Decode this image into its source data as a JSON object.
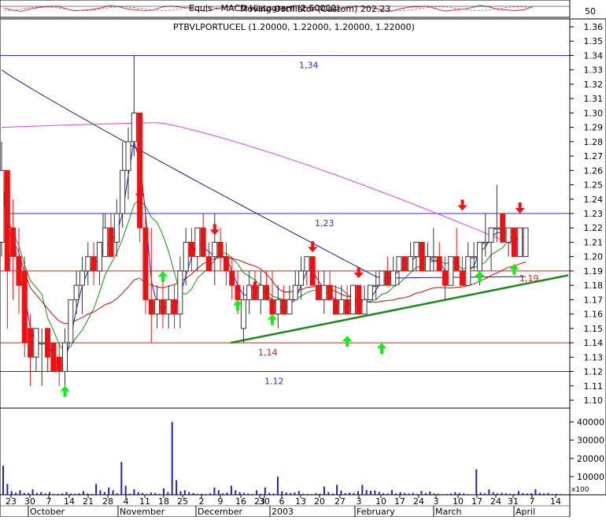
{
  "chart_data": {
    "type": "candlestick",
    "title": "PTBVLPORTUCEL (1.20000, 1.22000, 1.20000, 1.22000)",
    "indicator_panel": {
      "legend": "Equis - MACD Histogram (2.50000)",
      "legend_overlap": "Moving Oscillator (Custom) 202.23",
      "axis_label": "50"
    },
    "y_axis": {
      "min": 1.1,
      "max": 1.36,
      "ticks": [
        "1.10",
        "1.11",
        "1.12",
        "1.13",
        "1.14",
        "1.15",
        "1.16",
        "1.17",
        "1.18",
        "1.19",
        "1.20",
        "1.21",
        "1.22",
        "1.23",
        "1.24",
        "1.25",
        "1.26",
        "1.27",
        "1.28",
        "1.29",
        "1.30",
        "1.31",
        "1.32",
        "1.33",
        "1.34",
        "1.35",
        "1.36"
      ]
    },
    "volume_axis": {
      "max": 45000,
      "ticks": [
        "10000",
        "20000",
        "30000",
        "40000"
      ],
      "unit_label": "x100"
    },
    "x_axis": {
      "day_ticks": [
        "23",
        "30",
        "7",
        "14",
        "21",
        "28",
        "4",
        "11",
        "18",
        "25",
        "2",
        "9",
        "16",
        "23",
        "30",
        "6",
        "13",
        "20",
        "27",
        "3",
        "10",
        "17",
        "24",
        "3",
        "10",
        "17",
        "24",
        "31",
        "7",
        "14"
      ],
      "month_labels": [
        "October",
        "November",
        "December",
        "2003",
        "February",
        "March",
        "April"
      ]
    },
    "horizontal_levels": [
      {
        "value": 1.34,
        "label": "1,34",
        "color": "#2a2ac8"
      },
      {
        "value": 1.23,
        "label": "1,23",
        "color": "#2a2ac8"
      },
      {
        "value": 1.19,
        "label": "1,19",
        "color": "#cc2222"
      },
      {
        "value": 1.14,
        "label": "1,14",
        "color": "#cc2222"
      },
      {
        "value": 1.12,
        "label": "1.12",
        "color": "#2a2ac8"
      }
    ],
    "trendline": {
      "color": "#1a8a1a"
    },
    "colors": {
      "down": "#ee1111",
      "up_fill": "#ffffff",
      "up_stroke": "#333333",
      "ma_slow": "#dd44dd",
      "ma_mid": "#1a1a80",
      "ma_fast": "#1a1acc",
      "ma_green": "#1a8a1a",
      "ma_red": "#bb1111",
      "arrow_up": "#11ee11",
      "arrow_down": "#ee1111",
      "volume": "#2222bb",
      "grid": "#000000"
    },
    "bars": [
      {
        "o": 1.21,
        "h": 1.28,
        "l": 1.2,
        "c": 1.26
      },
      {
        "o": 1.26,
        "h": 1.26,
        "l": 1.15,
        "c": 1.19
      },
      {
        "o": 1.22,
        "h": 1.24,
        "l": 1.17,
        "c": 1.2
      },
      {
        "o": 1.2,
        "h": 1.22,
        "l": 1.16,
        "c": 1.18
      },
      {
        "o": 1.19,
        "h": 1.2,
        "l": 1.13,
        "c": 1.14
      },
      {
        "o": 1.15,
        "h": 1.16,
        "l": 1.11,
        "c": 1.13
      },
      {
        "o": 1.13,
        "h": 1.15,
        "l": 1.12,
        "c": 1.15
      },
      {
        "o": 1.14,
        "h": 1.15,
        "l": 1.11,
        "c": 1.14
      },
      {
        "o": 1.15,
        "h": 1.15,
        "l": 1.12,
        "c": 1.13
      },
      {
        "o": 1.14,
        "h": 1.14,
        "l": 1.12,
        "c": 1.12
      },
      {
        "o": 1.13,
        "h": 1.14,
        "l": 1.11,
        "c": 1.12
      },
      {
        "o": 1.12,
        "h": 1.15,
        "l": 1.11,
        "c": 1.14
      },
      {
        "o": 1.14,
        "h": 1.17,
        "l": 1.14,
        "c": 1.17
      },
      {
        "o": 1.17,
        "h": 1.19,
        "l": 1.16,
        "c": 1.18
      },
      {
        "o": 1.18,
        "h": 1.2,
        "l": 1.16,
        "c": 1.19
      },
      {
        "o": 1.19,
        "h": 1.21,
        "l": 1.18,
        "c": 1.2
      },
      {
        "o": 1.2,
        "h": 1.21,
        "l": 1.18,
        "c": 1.19
      },
      {
        "o": 1.19,
        "h": 1.21,
        "l": 1.18,
        "c": 1.21
      },
      {
        "o": 1.2,
        "h": 1.23,
        "l": 1.2,
        "c": 1.22
      },
      {
        "o": 1.22,
        "h": 1.23,
        "l": 1.2,
        "c": 1.2
      },
      {
        "o": 1.21,
        "h": 1.24,
        "l": 1.2,
        "c": 1.23
      },
      {
        "o": 1.23,
        "h": 1.28,
        "l": 1.22,
        "c": 1.26
      },
      {
        "o": 1.26,
        "h": 1.29,
        "l": 1.24,
        "c": 1.28
      },
      {
        "o": 1.28,
        "h": 1.34,
        "l": 1.27,
        "c": 1.3
      },
      {
        "o": 1.3,
        "h": 1.3,
        "l": 1.21,
        "c": 1.22
      },
      {
        "o": 1.22,
        "h": 1.23,
        "l": 1.16,
        "c": 1.17
      },
      {
        "o": 1.17,
        "h": 1.22,
        "l": 1.14,
        "c": 1.16
      },
      {
        "o": 1.16,
        "h": 1.18,
        "l": 1.15,
        "c": 1.17
      },
      {
        "o": 1.17,
        "h": 1.19,
        "l": 1.15,
        "c": 1.16
      },
      {
        "o": 1.16,
        "h": 1.18,
        "l": 1.15,
        "c": 1.17
      },
      {
        "o": 1.17,
        "h": 1.18,
        "l": 1.15,
        "c": 1.16
      },
      {
        "o": 1.16,
        "h": 1.2,
        "l": 1.15,
        "c": 1.19
      },
      {
        "o": 1.19,
        "h": 1.22,
        "l": 1.18,
        "c": 1.21
      },
      {
        "o": 1.21,
        "h": 1.22,
        "l": 1.19,
        "c": 1.2
      },
      {
        "o": 1.2,
        "h": 1.22,
        "l": 1.19,
        "c": 1.22
      },
      {
        "o": 1.22,
        "h": 1.23,
        "l": 1.2,
        "c": 1.2
      },
      {
        "o": 1.2,
        "h": 1.21,
        "l": 1.19,
        "c": 1.19
      },
      {
        "o": 1.2,
        "h": 1.23,
        "l": 1.18,
        "c": 1.21
      },
      {
        "o": 1.21,
        "h": 1.22,
        "l": 1.19,
        "c": 1.2
      },
      {
        "o": 1.2,
        "h": 1.21,
        "l": 1.18,
        "c": 1.19
      },
      {
        "o": 1.19,
        "h": 1.2,
        "l": 1.17,
        "c": 1.18
      },
      {
        "o": 1.18,
        "h": 1.19,
        "l": 1.16,
        "c": 1.17
      },
      {
        "o": 1.15,
        "h": 1.18,
        "l": 1.14,
        "c": 1.17
      },
      {
        "o": 1.17,
        "h": 1.19,
        "l": 1.16,
        "c": 1.18
      },
      {
        "o": 1.18,
        "h": 1.19,
        "l": 1.17,
        "c": 1.17
      },
      {
        "o": 1.17,
        "h": 1.19,
        "l": 1.16,
        "c": 1.18
      },
      {
        "o": 1.18,
        "h": 1.19,
        "l": 1.17,
        "c": 1.17
      },
      {
        "o": 1.17,
        "h": 1.19,
        "l": 1.16,
        "c": 1.16
      },
      {
        "o": 1.16,
        "h": 1.18,
        "l": 1.15,
        "c": 1.17
      },
      {
        "o": 1.17,
        "h": 1.18,
        "l": 1.16,
        "c": 1.16
      },
      {
        "o": 1.16,
        "h": 1.18,
        "l": 1.16,
        "c": 1.17
      },
      {
        "o": 1.17,
        "h": 1.19,
        "l": 1.17,
        "c": 1.18
      },
      {
        "o": 1.18,
        "h": 1.2,
        "l": 1.17,
        "c": 1.19
      },
      {
        "o": 1.19,
        "h": 1.2,
        "l": 1.18,
        "c": 1.2
      },
      {
        "o": 1.2,
        "h": 1.2,
        "l": 1.18,
        "c": 1.18
      },
      {
        "o": 1.18,
        "h": 1.19,
        "l": 1.17,
        "c": 1.17
      },
      {
        "o": 1.17,
        "h": 1.19,
        "l": 1.16,
        "c": 1.18
      },
      {
        "o": 1.18,
        "h": 1.19,
        "l": 1.17,
        "c": 1.17
      },
      {
        "o": 1.17,
        "h": 1.18,
        "l": 1.16,
        "c": 1.16
      },
      {
        "o": 1.16,
        "h": 1.18,
        "l": 1.16,
        "c": 1.17
      },
      {
        "o": 1.17,
        "h": 1.18,
        "l": 1.16,
        "c": 1.16
      },
      {
        "o": 1.16,
        "h": 1.18,
        "l": 1.16,
        "c": 1.18
      },
      {
        "o": 1.18,
        "h": 1.18,
        "l": 1.16,
        "c": 1.16
      },
      {
        "o": 1.16,
        "h": 1.18,
        "l": 1.16,
        "c": 1.17
      },
      {
        "o": 1.17,
        "h": 1.18,
        "l": 1.17,
        "c": 1.18
      },
      {
        "o": 1.18,
        "h": 1.19,
        "l": 1.17,
        "c": 1.18
      },
      {
        "o": 1.18,
        "h": 1.19,
        "l": 1.18,
        "c": 1.19
      },
      {
        "o": 1.19,
        "h": 1.2,
        "l": 1.18,
        "c": 1.18
      },
      {
        "o": 1.18,
        "h": 1.2,
        "l": 1.18,
        "c": 1.19
      },
      {
        "o": 1.19,
        "h": 1.2,
        "l": 1.18,
        "c": 1.2
      },
      {
        "o": 1.2,
        "h": 1.2,
        "l": 1.19,
        "c": 1.19
      },
      {
        "o": 1.19,
        "h": 1.21,
        "l": 1.19,
        "c": 1.2
      },
      {
        "o": 1.2,
        "h": 1.21,
        "l": 1.19,
        "c": 1.21
      },
      {
        "o": 1.21,
        "h": 1.21,
        "l": 1.19,
        "c": 1.19
      },
      {
        "o": 1.19,
        "h": 1.21,
        "l": 1.19,
        "c": 1.2
      },
      {
        "o": 1.2,
        "h": 1.22,
        "l": 1.19,
        "c": 1.2
      },
      {
        "o": 1.2,
        "h": 1.21,
        "l": 1.19,
        "c": 1.19
      },
      {
        "o": 1.19,
        "h": 1.2,
        "l": 1.17,
        "c": 1.18
      },
      {
        "o": 1.18,
        "h": 1.2,
        "l": 1.18,
        "c": 1.2
      },
      {
        "o": 1.2,
        "h": 1.22,
        "l": 1.19,
        "c": 1.19
      },
      {
        "o": 1.19,
        "h": 1.2,
        "l": 1.18,
        "c": 1.18
      },
      {
        "o": 1.18,
        "h": 1.21,
        "l": 1.18,
        "c": 1.2
      },
      {
        "o": 1.2,
        "h": 1.21,
        "l": 1.19,
        "c": 1.2
      },
      {
        "o": 1.19,
        "h": 1.21,
        "l": 1.18,
        "c": 1.21
      },
      {
        "o": 1.21,
        "h": 1.23,
        "l": 1.2,
        "c": 1.21
      },
      {
        "o": 1.21,
        "h": 1.22,
        "l": 1.19,
        "c": 1.22
      },
      {
        "o": 1.22,
        "h": 1.25,
        "l": 1.21,
        "c": 1.22
      },
      {
        "o": 1.23,
        "h": 1.23,
        "l": 1.21,
        "c": 1.21
      },
      {
        "o": 1.21,
        "h": 1.22,
        "l": 1.2,
        "c": 1.22
      },
      {
        "o": 1.22,
        "h": 1.22,
        "l": 1.2,
        "c": 1.2
      },
      {
        "o": 1.2,
        "h": 1.22,
        "l": 1.2,
        "c": 1.22
      },
      {
        "o": 1.2,
        "h": 1.22,
        "l": 1.2,
        "c": 1.22
      }
    ],
    "volume": [
      16000,
      6000,
      2000,
      1200,
      2500,
      1000,
      1000,
      3000,
      1000,
      1500,
      800,
      1500,
      500,
      500,
      800,
      1500,
      700,
      600,
      800,
      2000,
      700,
      500,
      6000,
      2500,
      1500,
      4000,
      2500,
      800,
      18000,
      5000,
      600,
      3000,
      1500,
      1000,
      500,
      1200,
      1000,
      500,
      3500,
      1500,
      40000,
      8000,
      2000,
      2500,
      1500,
      1000,
      500,
      600,
      400,
      800,
      4000,
      2500,
      800,
      1200,
      5000,
      2500,
      1500,
      1000,
      700,
      500,
      2500,
      600,
      4000,
      1000,
      700,
      10000,
      2000,
      1300,
      900,
      1300,
      2000,
      600,
      500,
      400,
      800,
      600,
      4500,
      1500,
      700,
      5500,
      2300,
      900,
      1200,
      1000,
      2000,
      5500,
      2600,
      2200,
      2400,
      1600,
      900,
      700,
      2700,
      800,
      1500,
      1000,
      700,
      1000,
      500,
      2100,
      1000,
      1800,
      800,
      600,
      400,
      500,
      700,
      1500,
      1000,
      700,
      300,
      200,
      14000,
      1200,
      800,
      3000,
      1400,
      800,
      1100,
      800,
      600,
      500,
      2000,
      1000,
      700,
      900,
      3000,
      1100,
      800,
      1000,
      500,
      600,
      400,
      300
    ]
  }
}
